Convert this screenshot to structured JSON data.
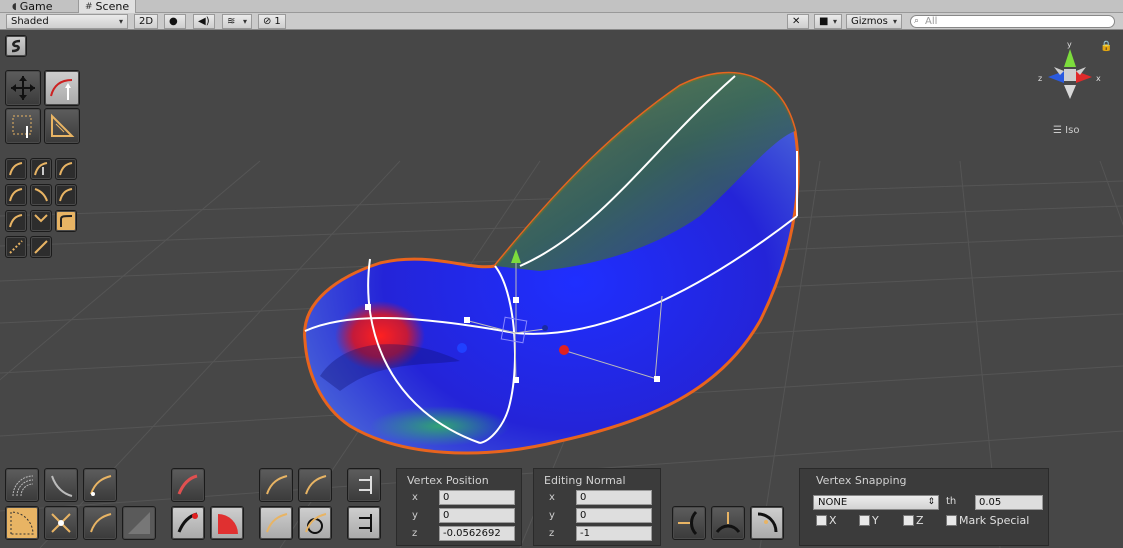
{
  "tabs": [
    {
      "label": "Game",
      "icon": "pacman-icon",
      "active": false
    },
    {
      "label": "Scene",
      "icon": "grid-icon",
      "active": true
    }
  ],
  "toolbar": {
    "shading_mode": "Shaded",
    "mode_2d": "2D",
    "effects_count": "1",
    "gizmos_label": "Gizmos",
    "search_placeholder": "All"
  },
  "gizmo": {
    "axis_y": "y",
    "axis_x": "x",
    "axis_z": "z",
    "projection": "Iso"
  },
  "vertex_position": {
    "title": "Vertex Position",
    "x_label": "x",
    "x": "0",
    "y_label": "y",
    "y": "0",
    "z_label": "z",
    "z": "-0.0562692"
  },
  "editing_normal": {
    "title": "Editing Normal",
    "x_label": "x",
    "x": "0",
    "y_label": "y",
    "y": "0",
    "z_label": "z",
    "z": "-1"
  },
  "vertex_snapping": {
    "title": "Vertex Snapping",
    "mode": "NONE",
    "threshold_label": "th",
    "threshold": "0.05",
    "checkboxes": [
      "X",
      "Y",
      "Z",
      "Mark Special"
    ]
  },
  "colors": {
    "accent": "#e8b464",
    "outline": "#e8641e",
    "background": "#474747"
  }
}
